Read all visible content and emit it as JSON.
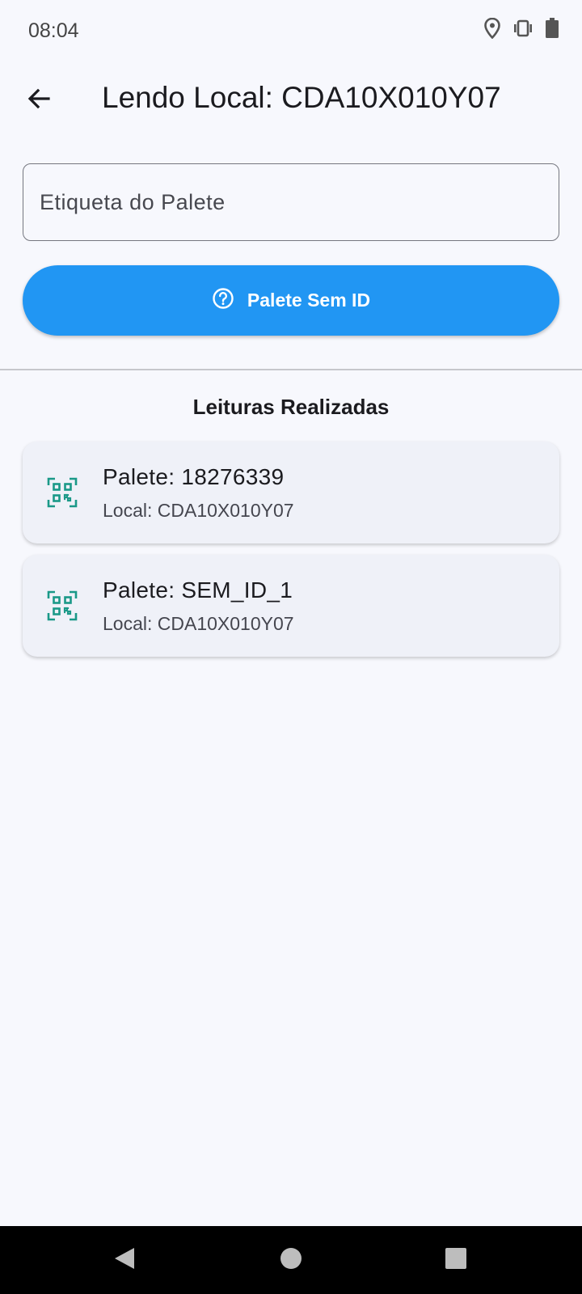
{
  "status_bar": {
    "time": "08:04",
    "icons": [
      "location-icon",
      "vibrate-icon",
      "battery-icon"
    ]
  },
  "app_bar": {
    "back_icon": "arrow-back-icon",
    "title": "Lendo Local: CDA10X010Y07"
  },
  "form": {
    "pallet_label_placeholder": "Etiqueta do Palete",
    "pallet_label_value": "",
    "no_id_button_label": "Palete Sem ID",
    "no_id_button_icon": "help-circle-icon",
    "accent_color": "#2196f3"
  },
  "readings": {
    "title": "Leituras Realizadas",
    "items": [
      {
        "icon": "qr-code-scanner-icon",
        "primary": "Palete: 18276339",
        "secondary": "Local: CDA10X010Y07"
      },
      {
        "icon": "qr-code-scanner-icon",
        "primary": "Palete: SEM_ID_1",
        "secondary": "Local: CDA10X010Y07"
      }
    ],
    "icon_color": "#1a9988"
  },
  "nav_bar": {
    "buttons": [
      "nav-back-icon",
      "nav-home-icon",
      "nav-recents-icon"
    ]
  }
}
